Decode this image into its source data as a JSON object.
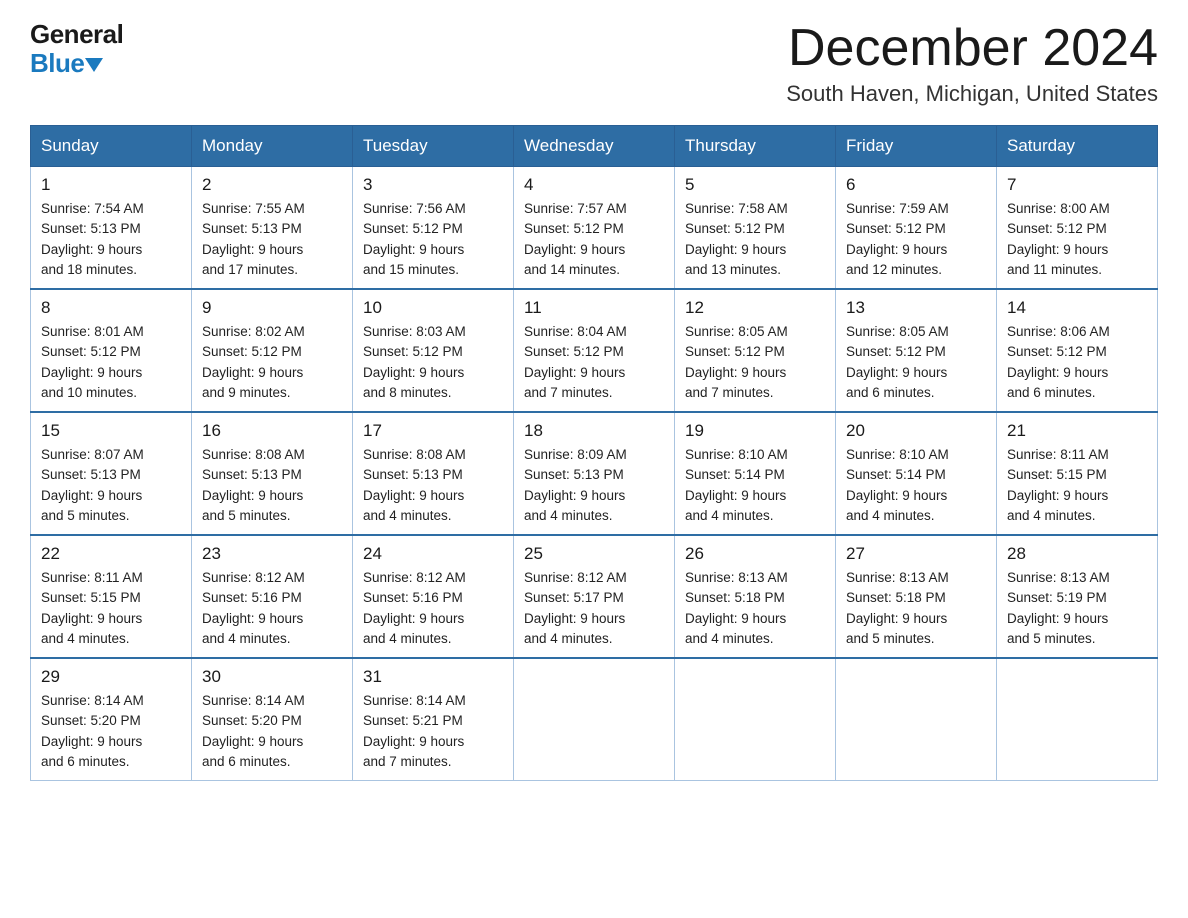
{
  "header": {
    "logo_general": "General",
    "logo_blue": "Blue",
    "main_title": "December 2024",
    "subtitle": "South Haven, Michigan, United States"
  },
  "weekdays": [
    "Sunday",
    "Monday",
    "Tuesday",
    "Wednesday",
    "Thursday",
    "Friday",
    "Saturday"
  ],
  "weeks": [
    [
      {
        "day": "1",
        "sunrise": "7:54 AM",
        "sunset": "5:13 PM",
        "daylight": "9 hours and 18 minutes."
      },
      {
        "day": "2",
        "sunrise": "7:55 AM",
        "sunset": "5:13 PM",
        "daylight": "9 hours and 17 minutes."
      },
      {
        "day": "3",
        "sunrise": "7:56 AM",
        "sunset": "5:12 PM",
        "daylight": "9 hours and 15 minutes."
      },
      {
        "day": "4",
        "sunrise": "7:57 AM",
        "sunset": "5:12 PM",
        "daylight": "9 hours and 14 minutes."
      },
      {
        "day": "5",
        "sunrise": "7:58 AM",
        "sunset": "5:12 PM",
        "daylight": "9 hours and 13 minutes."
      },
      {
        "day": "6",
        "sunrise": "7:59 AM",
        "sunset": "5:12 PM",
        "daylight": "9 hours and 12 minutes."
      },
      {
        "day": "7",
        "sunrise": "8:00 AM",
        "sunset": "5:12 PM",
        "daylight": "9 hours and 11 minutes."
      }
    ],
    [
      {
        "day": "8",
        "sunrise": "8:01 AM",
        "sunset": "5:12 PM",
        "daylight": "9 hours and 10 minutes."
      },
      {
        "day": "9",
        "sunrise": "8:02 AM",
        "sunset": "5:12 PM",
        "daylight": "9 hours and 9 minutes."
      },
      {
        "day": "10",
        "sunrise": "8:03 AM",
        "sunset": "5:12 PM",
        "daylight": "9 hours and 8 minutes."
      },
      {
        "day": "11",
        "sunrise": "8:04 AM",
        "sunset": "5:12 PM",
        "daylight": "9 hours and 7 minutes."
      },
      {
        "day": "12",
        "sunrise": "8:05 AM",
        "sunset": "5:12 PM",
        "daylight": "9 hours and 7 minutes."
      },
      {
        "day": "13",
        "sunrise": "8:05 AM",
        "sunset": "5:12 PM",
        "daylight": "9 hours and 6 minutes."
      },
      {
        "day": "14",
        "sunrise": "8:06 AM",
        "sunset": "5:12 PM",
        "daylight": "9 hours and 6 minutes."
      }
    ],
    [
      {
        "day": "15",
        "sunrise": "8:07 AM",
        "sunset": "5:13 PM",
        "daylight": "9 hours and 5 minutes."
      },
      {
        "day": "16",
        "sunrise": "8:08 AM",
        "sunset": "5:13 PM",
        "daylight": "9 hours and 5 minutes."
      },
      {
        "day": "17",
        "sunrise": "8:08 AM",
        "sunset": "5:13 PM",
        "daylight": "9 hours and 4 minutes."
      },
      {
        "day": "18",
        "sunrise": "8:09 AM",
        "sunset": "5:13 PM",
        "daylight": "9 hours and 4 minutes."
      },
      {
        "day": "19",
        "sunrise": "8:10 AM",
        "sunset": "5:14 PM",
        "daylight": "9 hours and 4 minutes."
      },
      {
        "day": "20",
        "sunrise": "8:10 AM",
        "sunset": "5:14 PM",
        "daylight": "9 hours and 4 minutes."
      },
      {
        "day": "21",
        "sunrise": "8:11 AM",
        "sunset": "5:15 PM",
        "daylight": "9 hours and 4 minutes."
      }
    ],
    [
      {
        "day": "22",
        "sunrise": "8:11 AM",
        "sunset": "5:15 PM",
        "daylight": "9 hours and 4 minutes."
      },
      {
        "day": "23",
        "sunrise": "8:12 AM",
        "sunset": "5:16 PM",
        "daylight": "9 hours and 4 minutes."
      },
      {
        "day": "24",
        "sunrise": "8:12 AM",
        "sunset": "5:16 PM",
        "daylight": "9 hours and 4 minutes."
      },
      {
        "day": "25",
        "sunrise": "8:12 AM",
        "sunset": "5:17 PM",
        "daylight": "9 hours and 4 minutes."
      },
      {
        "day": "26",
        "sunrise": "8:13 AM",
        "sunset": "5:18 PM",
        "daylight": "9 hours and 4 minutes."
      },
      {
        "day": "27",
        "sunrise": "8:13 AM",
        "sunset": "5:18 PM",
        "daylight": "9 hours and 5 minutes."
      },
      {
        "day": "28",
        "sunrise": "8:13 AM",
        "sunset": "5:19 PM",
        "daylight": "9 hours and 5 minutes."
      }
    ],
    [
      {
        "day": "29",
        "sunrise": "8:14 AM",
        "sunset": "5:20 PM",
        "daylight": "9 hours and 6 minutes."
      },
      {
        "day": "30",
        "sunrise": "8:14 AM",
        "sunset": "5:20 PM",
        "daylight": "9 hours and 6 minutes."
      },
      {
        "day": "31",
        "sunrise": "8:14 AM",
        "sunset": "5:21 PM",
        "daylight": "9 hours and 7 minutes."
      },
      null,
      null,
      null,
      null
    ]
  ]
}
